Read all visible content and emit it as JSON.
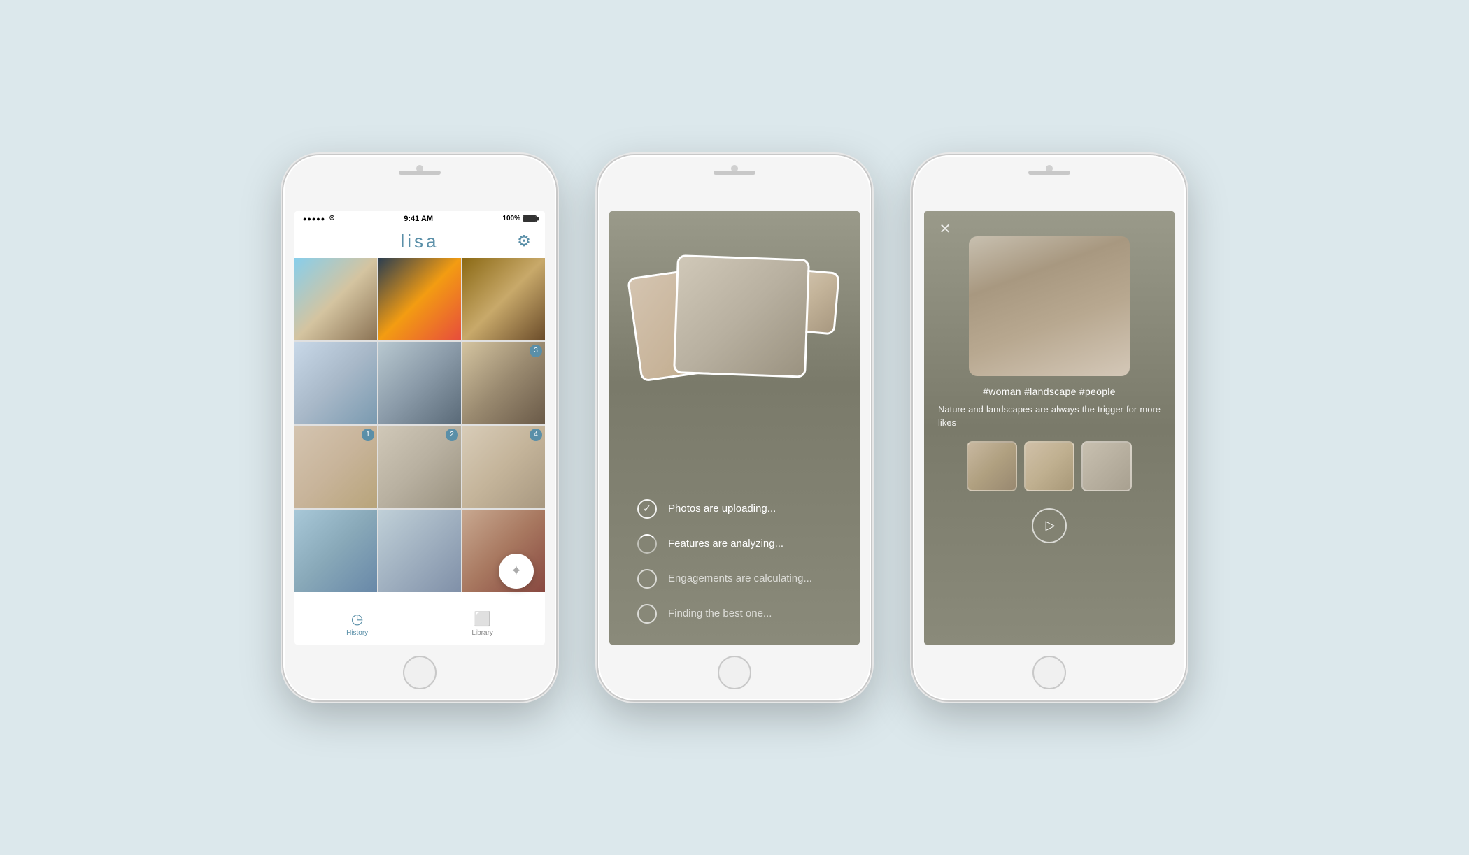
{
  "background": "#e8ecee",
  "phones": {
    "phone1": {
      "statusBar": {
        "signal": "●●●●●",
        "wifi": "wifi",
        "time": "9:41 AM",
        "batteryPercent": "100%"
      },
      "header": {
        "title": "lisa",
        "settingsLabel": "⚙"
      },
      "photos": [
        {
          "id": 1,
          "style": "skate",
          "badge": null,
          "row": 0,
          "col": 0
        },
        {
          "id": 2,
          "style": "city",
          "badge": null,
          "row": 0,
          "col": 1
        },
        {
          "id": 3,
          "style": "cafe",
          "badge": null,
          "row": 0,
          "col": 2
        },
        {
          "id": 4,
          "style": "park",
          "badge": null,
          "row": 1,
          "col": 0
        },
        {
          "id": 5,
          "style": "street",
          "badge": null,
          "row": 1,
          "col": 1
        },
        {
          "id": 6,
          "style": "road",
          "badge": "3",
          "row": 1,
          "col": 2
        },
        {
          "id": 7,
          "style": "hat1",
          "badge": "1",
          "row": 2,
          "col": 0
        },
        {
          "id": 8,
          "style": "hat2",
          "badge": "2",
          "row": 2,
          "col": 1
        },
        {
          "id": 9,
          "style": "hat3",
          "badge": "4",
          "row": 2,
          "col": 2
        },
        {
          "id": 10,
          "style": "girls",
          "badge": null,
          "row": 3,
          "col": 0
        },
        {
          "id": 11,
          "style": "girls2",
          "badge": null,
          "row": 3,
          "col": 1
        },
        {
          "id": 12,
          "style": "smile",
          "badge": null,
          "row": 3,
          "col": 2
        }
      ],
      "magicButton": "✦",
      "tabs": [
        {
          "label": "History",
          "icon": "clock",
          "active": true
        },
        {
          "label": "Library",
          "icon": "library",
          "active": false
        }
      ]
    },
    "phone2": {
      "uploadStatus": [
        {
          "text": "Photos are uploading...",
          "done": true
        },
        {
          "text": "Features are analyzing...",
          "done": false
        },
        {
          "text": "Engagements are calculating...",
          "done": false
        },
        {
          "text": "Finding the best one...",
          "done": false
        }
      ]
    },
    "phone3": {
      "closeLabel": "✕",
      "tags": "#woman #landscape #people",
      "caption": "Nature and landscapes are always the trigger for more likes",
      "shareIcon": "▷"
    }
  }
}
